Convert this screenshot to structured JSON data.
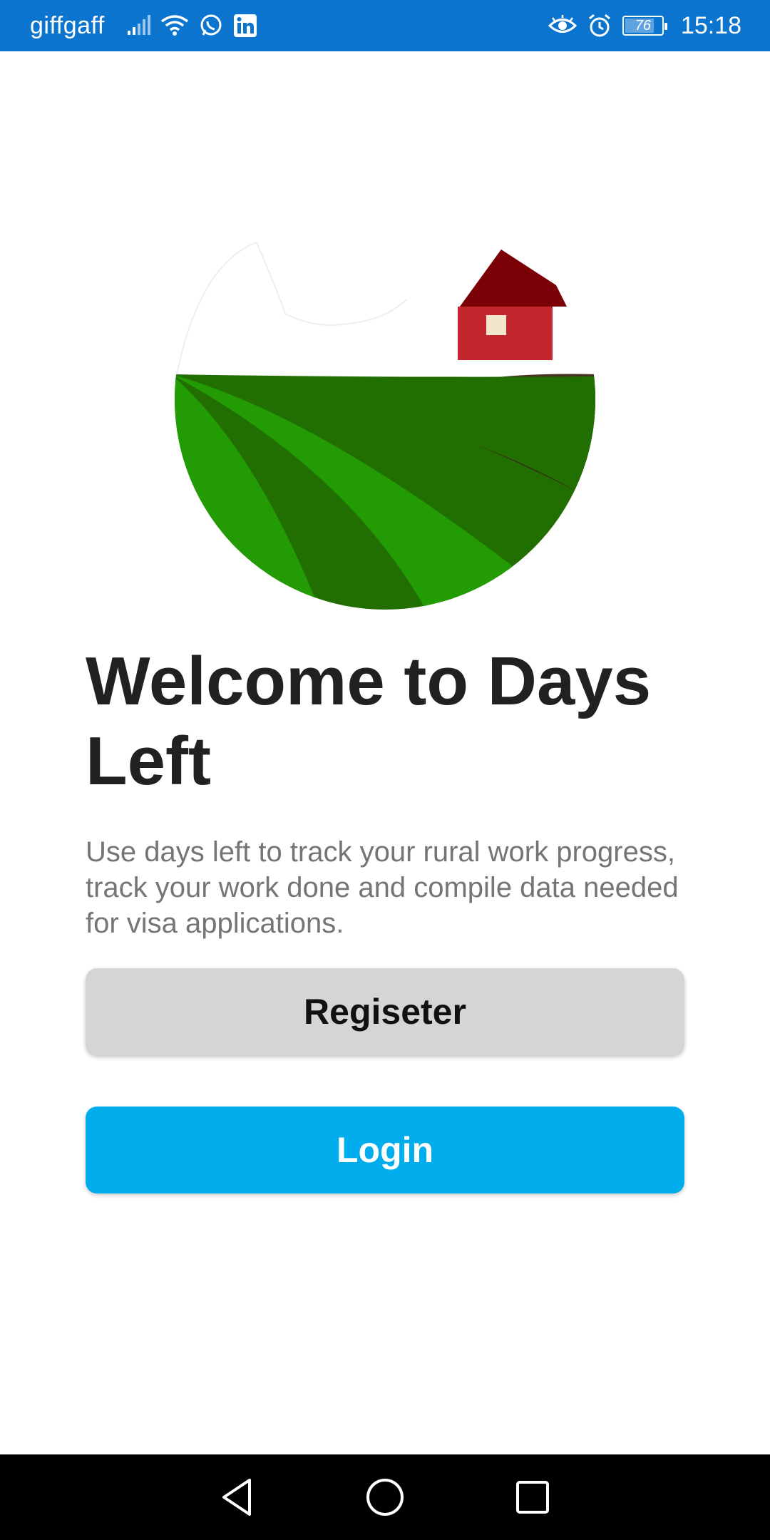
{
  "status_bar": {
    "carrier": "giffgaff",
    "time": "15:18",
    "battery_percent": "76",
    "icons": [
      "signal-icon",
      "wifi-icon",
      "whatsapp-icon",
      "linkedin-icon",
      "eye-icon",
      "alarm-icon",
      "battery-icon"
    ],
    "background_color": "#0a74cf"
  },
  "welcome": {
    "title": "Welcome to Days Left",
    "description": "Use days left to track your rural work progress, track your work done and compile data needed for visa applications."
  },
  "buttons": {
    "register_label": "Regiseter",
    "login_label": "Login"
  },
  "colors": {
    "register_bg": "#d5d5d5",
    "login_bg": "#02adee",
    "title_text": "#212121",
    "body_text": "#757575"
  },
  "nav_bar": {
    "icons": [
      "back-icon",
      "home-icon",
      "recents-icon"
    ]
  }
}
